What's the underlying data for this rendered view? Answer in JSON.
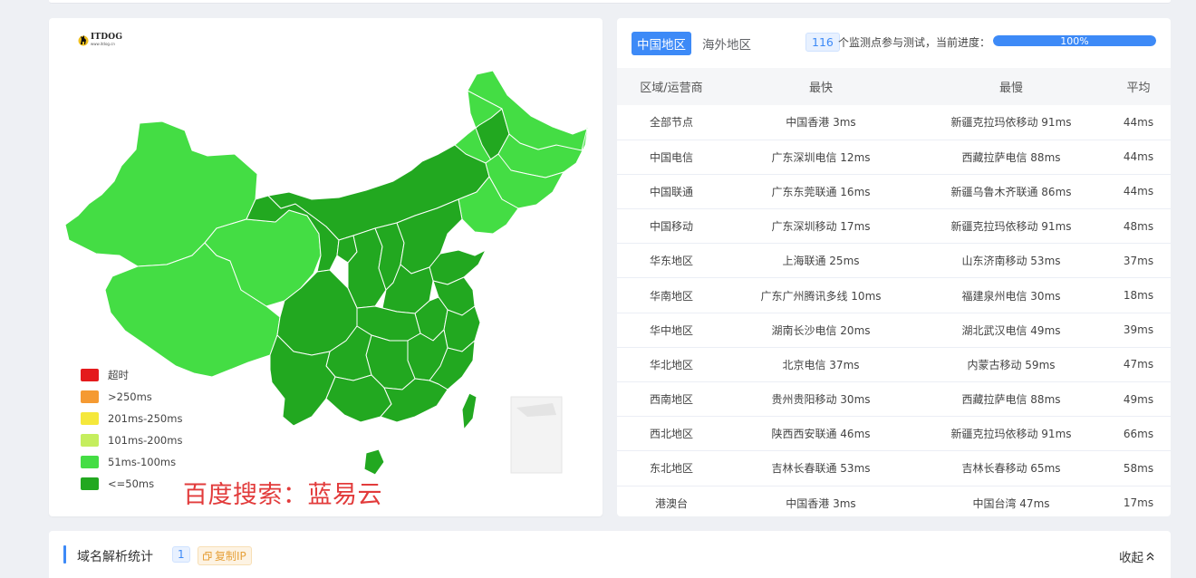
{
  "colors": {
    "accent": "#3d8af7",
    "map_fast": "#22a820",
    "map_medium": "#44dd44",
    "watermark": "#e23b3b"
  },
  "map": {
    "logo_text": "ITDOG",
    "logo_sub": "www.itdog.cn",
    "legend": [
      {
        "label": "超时",
        "color": "#e41a1c"
      },
      {
        "label": ">250ms",
        "color": "#f59a32"
      },
      {
        "label": "201ms-250ms",
        "color": "#f5e83b"
      },
      {
        "label": "101ms-200ms",
        "color": "#c5ee5e"
      },
      {
        "label": "51ms-100ms",
        "color": "#44dd44"
      },
      {
        "label": "<=50ms",
        "color": "#22a820"
      }
    ],
    "watermark": "百度搜索：蓝易云"
  },
  "panel": {
    "tabs": [
      {
        "label": "中国地区",
        "active": true
      },
      {
        "label": "海外地区",
        "active": false
      }
    ],
    "monitor_count": "116",
    "monitor_text": "个监测点参与测试，当前进度：",
    "progress_label": "100%",
    "progress_value": 100
  },
  "table": {
    "headers": [
      "区域/运营商",
      "最快",
      "最慢",
      "平均"
    ],
    "rows": [
      [
        "全部节点",
        "中国香港 3ms",
        "新疆克拉玛依移动 91ms",
        "44ms"
      ],
      [
        "中国电信",
        "广东深圳电信 12ms",
        "西藏拉萨电信 88ms",
        "44ms"
      ],
      [
        "中国联通",
        "广东东莞联通 16ms",
        "新疆乌鲁木齐联通 86ms",
        "44ms"
      ],
      [
        "中国移动",
        "广东深圳移动 17ms",
        "新疆克拉玛依移动 91ms",
        "48ms"
      ],
      [
        "华东地区",
        "上海联通 25ms",
        "山东济南移动 53ms",
        "37ms"
      ],
      [
        "华南地区",
        "广东广州腾讯多线 10ms",
        "福建泉州电信 30ms",
        "18ms"
      ],
      [
        "华中地区",
        "湖南长沙电信 20ms",
        "湖北武汉电信 49ms",
        "39ms"
      ],
      [
        "华北地区",
        "北京电信 37ms",
        "内蒙古移动 59ms",
        "47ms"
      ],
      [
        "西南地区",
        "贵州贵阳移动 30ms",
        "西藏拉萨电信 88ms",
        "49ms"
      ],
      [
        "西北地区",
        "陕西西安联通 46ms",
        "新疆克拉玛依移动 91ms",
        "66ms"
      ],
      [
        "东北地区",
        "吉林长春联通 53ms",
        "吉林长春移动 65ms",
        "58ms"
      ],
      [
        "港澳台",
        "中国香港 3ms",
        "中国台湾 47ms",
        "17ms"
      ]
    ]
  },
  "dns": {
    "title": "域名解析统计",
    "count": "1",
    "copy_label": "复制IP",
    "collapse_label": "收起"
  }
}
